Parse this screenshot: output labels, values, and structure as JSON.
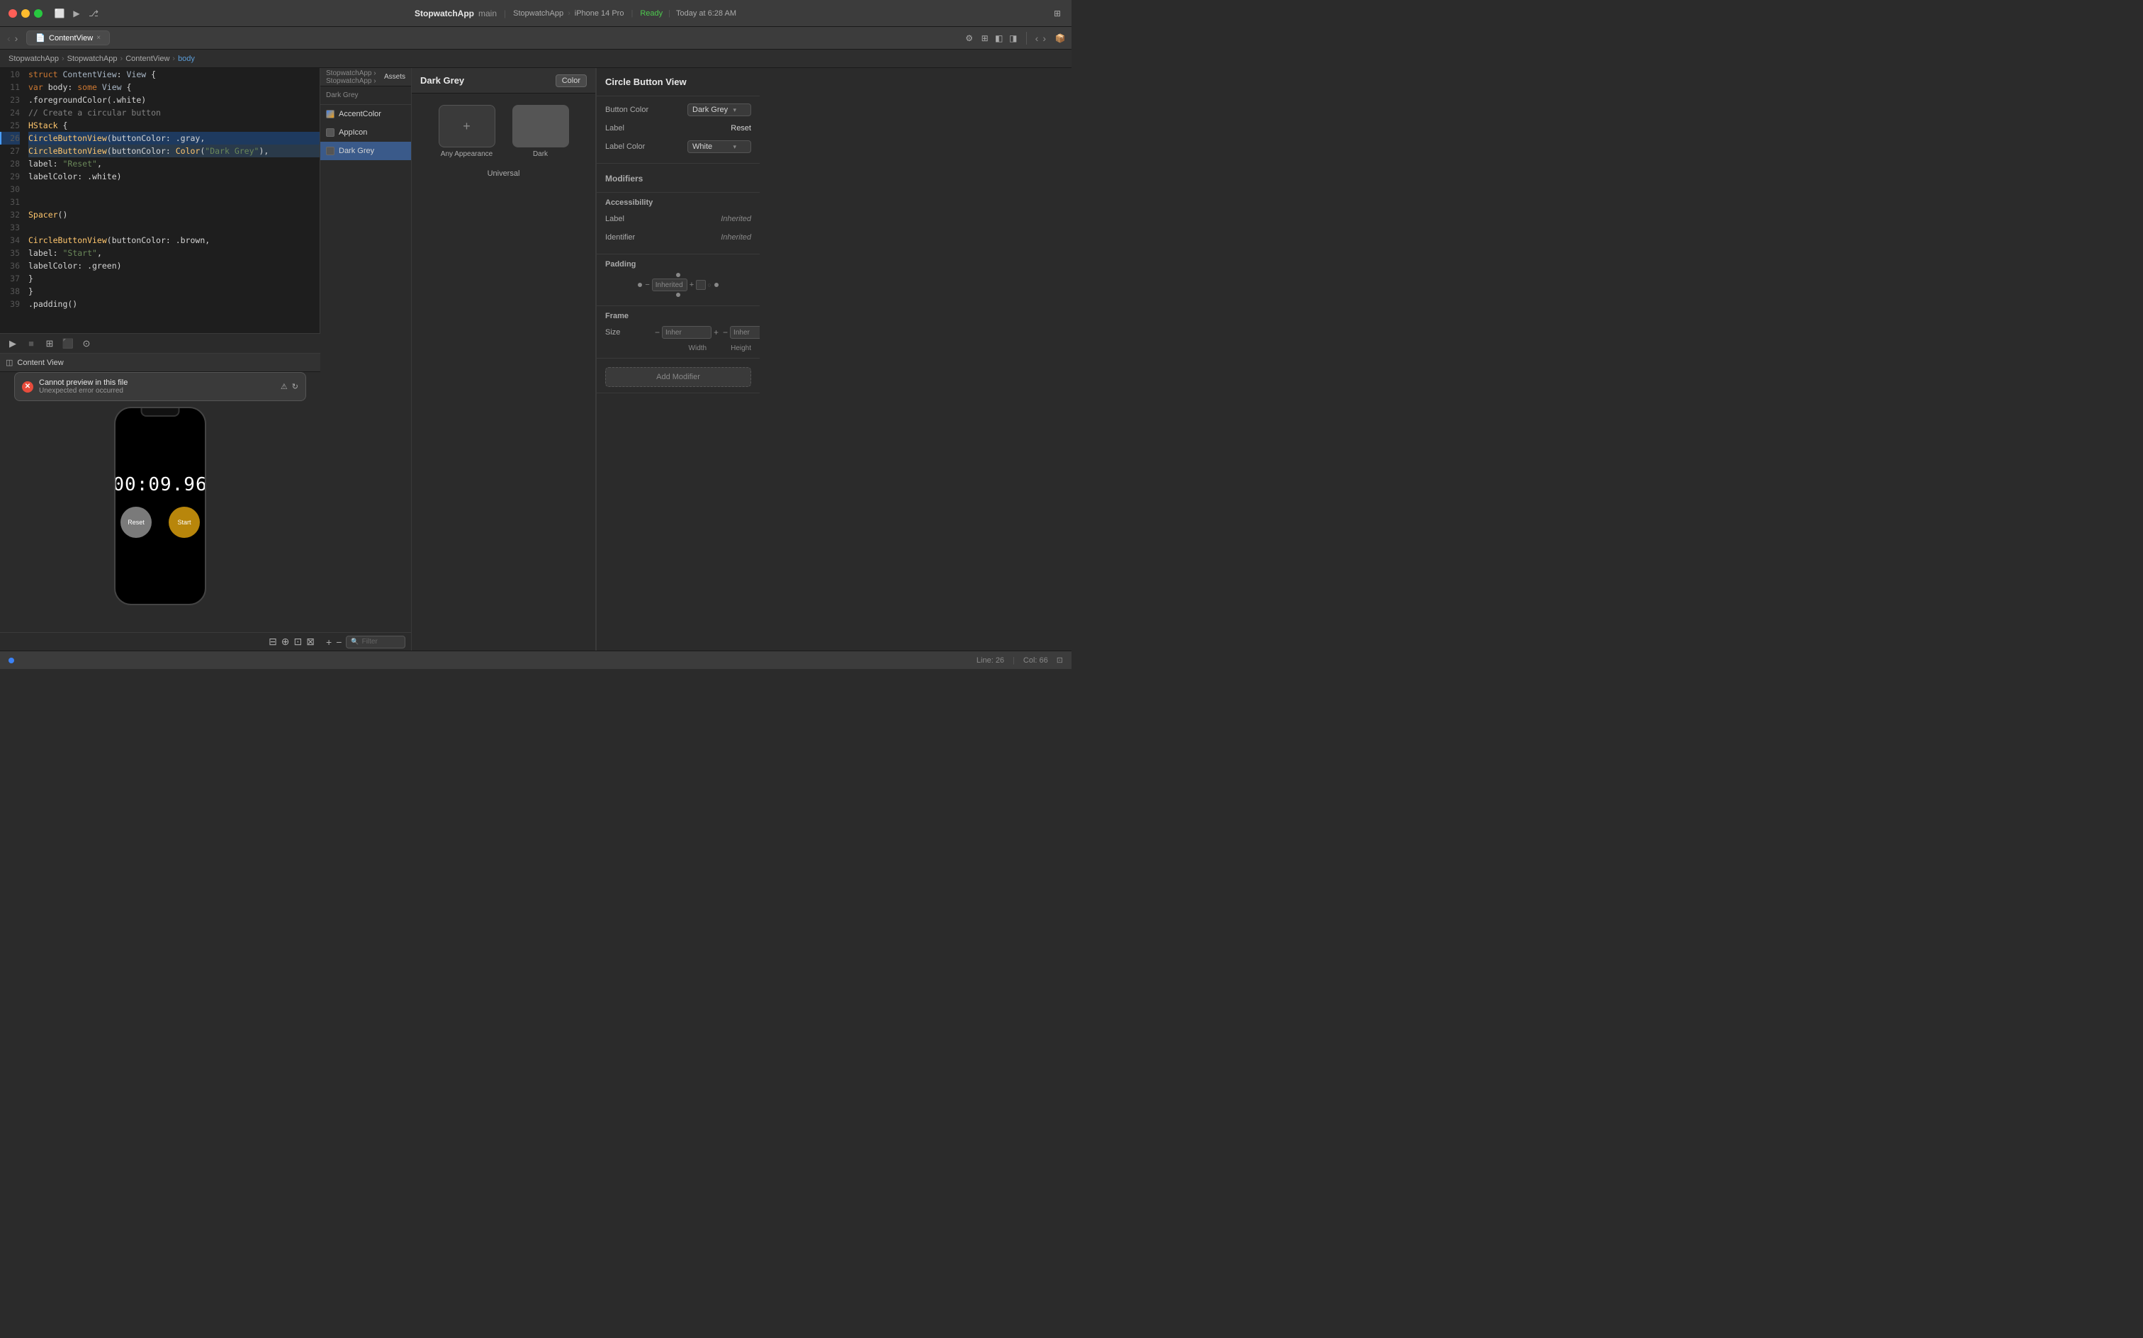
{
  "titlebar": {
    "app_name": "StopwatchApp",
    "subtitle": "main",
    "device": "StopwatchApp",
    "status": "Ready",
    "time": "Today at 6:28 AM",
    "scheme": "StopwatchApp",
    "simulator": "iPhone 14 Pro"
  },
  "tabs": [
    {
      "label": "ContentView",
      "active": true
    }
  ],
  "breadcrumb": {
    "items": [
      "StopwatchApp",
      "StopwatchApp",
      "ContentView",
      "body"
    ]
  },
  "code": {
    "lines": [
      {
        "num": "10",
        "content": "struct ContentView: View {"
      },
      {
        "num": "11",
        "content": "    var body: some View {"
      },
      {
        "num": "23",
        "content": ""
      },
      {
        "num": "24",
        "content": "        // Create a circular button"
      },
      {
        "num": "25",
        "content": "        HStack {"
      },
      {
        "num": "26",
        "content": "            CircleButtonView(buttonColor: .gray,",
        "highlighted": true,
        "current": true
      },
      {
        "num": "27",
        "content": "            CircleButtonView(buttonColor: Color(\"Dark Grey\"),",
        "current": true
      },
      {
        "num": "28",
        "content": "                    label: \"Reset\","
      },
      {
        "num": "29",
        "content": "                    labelColor: .white)"
      },
      {
        "num": "30",
        "content": ""
      },
      {
        "num": "31",
        "content": ""
      },
      {
        "num": "32",
        "content": "            Spacer()"
      },
      {
        "num": "33",
        "content": ""
      },
      {
        "num": "34",
        "content": "            CircleButtonView(buttonColor: .brown,"
      },
      {
        "num": "35",
        "content": "                    label: \"Start\","
      },
      {
        "num": "36",
        "content": "                    labelColor: .green)"
      },
      {
        "num": "37",
        "content": "        }"
      },
      {
        "num": "38",
        "content": "        }"
      },
      {
        "num": "39",
        "content": "        .padding()"
      }
    ]
  },
  "preview": {
    "header": "Content View",
    "error": {
      "title": "Cannot preview in this file",
      "subtitle": "Unexpected error occurred"
    },
    "timer": "00:09.96",
    "reset_label": "Reset",
    "start_label": "Start"
  },
  "assets": {
    "header": "Assets",
    "items": [
      {
        "name": "AccentColor",
        "type": "accent"
      },
      {
        "name": "AppIcon",
        "type": "appicon"
      },
      {
        "name": "Dark Grey",
        "type": "darkgrey",
        "selected": true
      }
    ],
    "filter_placeholder": "Filter"
  },
  "color_editor": {
    "name": "Dark Grey",
    "button_label": "Color",
    "any_appearance_label": "Any Appearance",
    "dark_label": "Dark",
    "universal_label": "Universal"
  },
  "inspector": {
    "title": "Circle Button View",
    "button_color_label": "Button Color",
    "button_color_value": "Dark Grey",
    "label_label": "Label",
    "label_value": "Reset",
    "label_color_label": "Label Color",
    "label_color_value": "White",
    "modifiers_label": "Modifiers",
    "accessibility_label": "Accessibility",
    "acc_label_label": "Label",
    "acc_label_value": "Inherited",
    "acc_identifier_label": "Identifier",
    "acc_identifier_value": "Inherited",
    "padding_label": "Padding",
    "padding_section": "Padding",
    "padding_value": "Inherited",
    "frame_label": "Frame",
    "size_label": "Size",
    "width_label": "Width",
    "height_label": "Height",
    "width_value": "Inher",
    "height_value": "Inher",
    "add_modifier": "Add Modifier"
  },
  "statusbar": {
    "line": "Line: 26",
    "col": "Col: 66"
  },
  "icons": {
    "play": "▶",
    "stop": "■",
    "grid": "⊞",
    "debug": "🐛",
    "settings": "⚙",
    "chevron_left": "‹",
    "chevron_right": "›",
    "close": "×",
    "search": "🔍",
    "plus": "+",
    "minus": "−",
    "zoom_in": "+",
    "zoom_out": "−",
    "zoom_fit": "⊡",
    "zoom_actual": "⊟",
    "assets": "📦",
    "branch": "⎇",
    "warning": "⚠",
    "refresh": "↻"
  }
}
